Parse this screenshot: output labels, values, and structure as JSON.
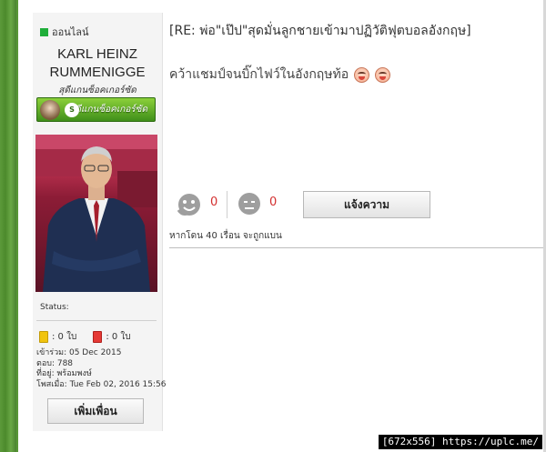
{
  "sidebar": {
    "online_label": "ออนไลน์",
    "username_line1": "KARL HEINZ",
    "username_line2": "RUMMENIGGE",
    "rank_title": "สุดีแกนซ็อคเกอร์ซัด",
    "rank_badge_text": "สุดีแกนซ็อคเกอร์ซัด",
    "status_label": "Status:",
    "yellow_cards": ": 0 ใบ",
    "red_cards": ": 0 ใบ",
    "joined": "เข้าร่วม: 05 Dec 2015",
    "replies": "ตอบ: 788",
    "location": "ที่อยู่: พร้อมพงษ์",
    "posted": "โพสเมื่อ: Tue Feb 02, 2016 15:56",
    "add_friend_label": "เพิ่มเพื่อน"
  },
  "post": {
    "title": "[RE: พ่อ\"เป๊ป\"สุดมั่นลูกชายเข้ามาปฏิวัติฟุตบอลอังกฤษ]",
    "body": "คว้าแชมป์จนบิ๊กไฟว์ในอังกฤษท้อ",
    "like_count": "0",
    "meh_count": "0",
    "report_label": "แจ้งความ",
    "warning": "หากโดน 40 เรื่อน จะถูกแบน"
  },
  "watermark": "[672x556] https://uplc.me/",
  "colors": {
    "online": "#1fae3a",
    "count": "#d32f2f",
    "badge": "#5fae2a"
  }
}
